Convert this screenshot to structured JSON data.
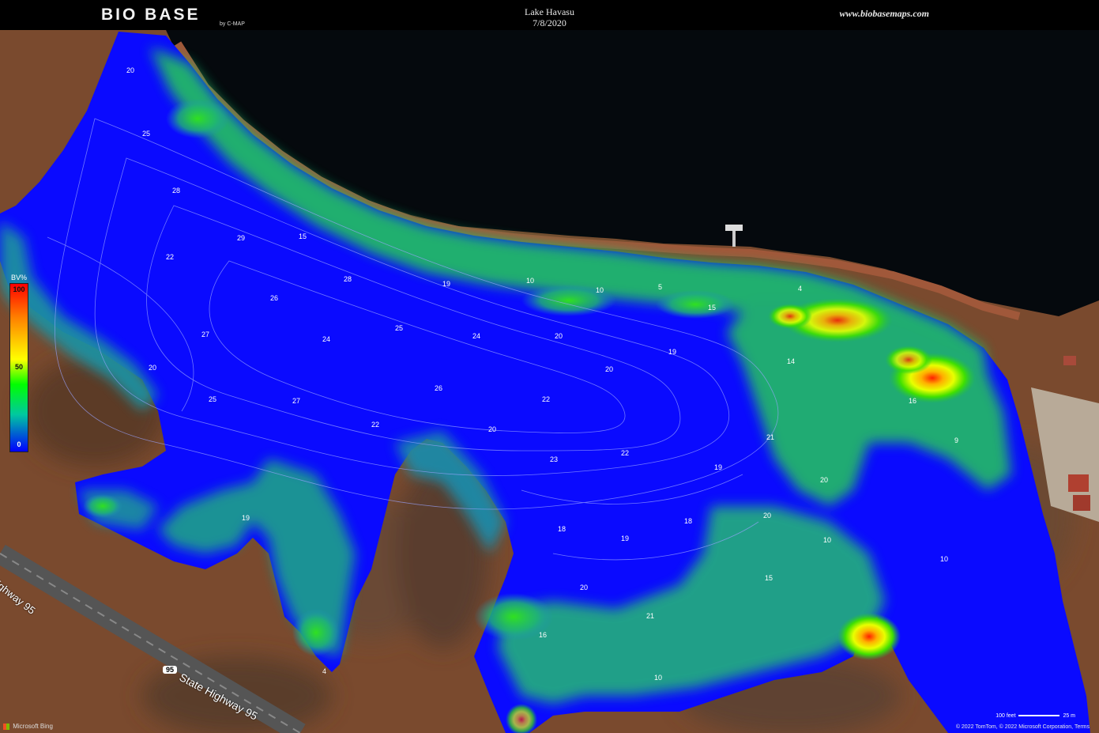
{
  "header": {
    "logo_text": "BIO BASE",
    "logo_sub": "by C-MAP",
    "map_title": "Lake Havasu",
    "map_date": "7/8/2020",
    "url": "www.biobasemaps.com"
  },
  "legend": {
    "title": "BV%",
    "max_label": "100",
    "mid_label": "50",
    "min_label": "0"
  },
  "roads": {
    "highway_label": "State Highway 95",
    "highway_label_short": "Highway 95",
    "shield_number": "95"
  },
  "footer": {
    "bing_label": "Microsoft Bing",
    "copyright": "© 2022 TomTom, © 2022 Microsoft Corporation, Terms",
    "scale_feet": "100 feet",
    "scale_meters": "25 m"
  },
  "depth_labels": [
    "20",
    "25",
    "28",
    "22",
    "29",
    "28",
    "15",
    "26",
    "27",
    "24",
    "25",
    "19",
    "10",
    "10",
    "5",
    "15",
    "4",
    "20",
    "20",
    "19",
    "14",
    "26",
    "24",
    "16",
    "9",
    "21",
    "20",
    "25",
    "27",
    "22",
    "20",
    "22",
    "23",
    "22",
    "19",
    "20",
    "20",
    "18",
    "19",
    "18",
    "10",
    "10",
    "15",
    "20",
    "21",
    "19",
    "4",
    "16",
    "10"
  ],
  "colors": {
    "water_deep": "#0a0aff",
    "land": "#7a4a2e",
    "lake_dark": "#05090d"
  }
}
